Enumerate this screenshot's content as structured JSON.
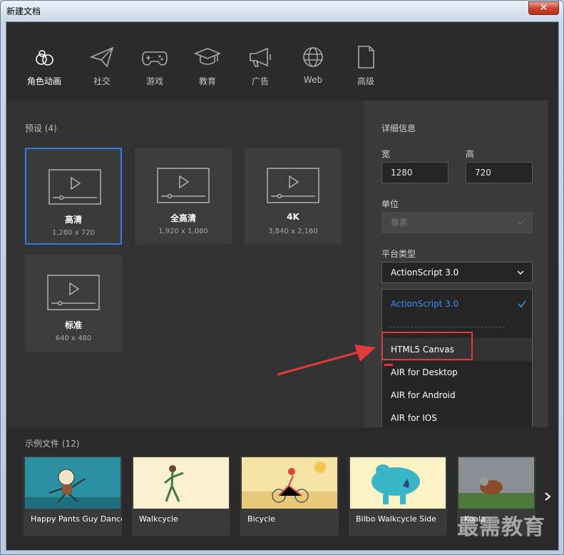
{
  "window": {
    "title": "新建文档",
    "close_label": "✕"
  },
  "categories": [
    {
      "label": "角色动画",
      "icon": "character-animation-icon",
      "active": true
    },
    {
      "label": "社交",
      "icon": "paper-plane-icon"
    },
    {
      "label": "游戏",
      "icon": "gamepad-icon"
    },
    {
      "label": "教育",
      "icon": "graduation-cap-icon"
    },
    {
      "label": "广告",
      "icon": "megaphone-icon"
    },
    {
      "label": "Web",
      "icon": "globe-icon"
    },
    {
      "label": "高级",
      "icon": "document-icon"
    }
  ],
  "presets": {
    "label": "预设 (4)",
    "items": [
      {
        "name": "高清",
        "size": "1,280 x 720",
        "selected": true
      },
      {
        "name": "全高清",
        "size": "1,920 x 1,080"
      },
      {
        "name": "4K",
        "size": "3,840 x 2,160"
      },
      {
        "name": "标准",
        "size": "640 x 480"
      }
    ]
  },
  "details": {
    "title": "详细信息",
    "width_label": "宽",
    "width_value": "1280",
    "height_label": "高",
    "height_value": "720",
    "unit_label": "单位",
    "unit_value": "像素",
    "platform_label": "平台类型",
    "platform_value": "ActionScript 3.0",
    "platform_options": [
      "ActionScript 3.0",
      "HTML5 Canvas",
      "AIR for Desktop",
      "AIR for Android",
      "AIR for IOS"
    ]
  },
  "samples": {
    "label": "示例文件 (12)",
    "items": [
      {
        "caption": "Happy Pants Guy Dance"
      },
      {
        "caption": "Walkcycle"
      },
      {
        "caption": "Bicycle"
      },
      {
        "caption": "Bilbo Walkcycle Side"
      },
      {
        "caption": "Koala"
      }
    ]
  },
  "watermark": "最需教育",
  "colors": {
    "accent": "#2e7ee8",
    "highlight": "#e03a3a",
    "background": "#2b2b2b"
  }
}
